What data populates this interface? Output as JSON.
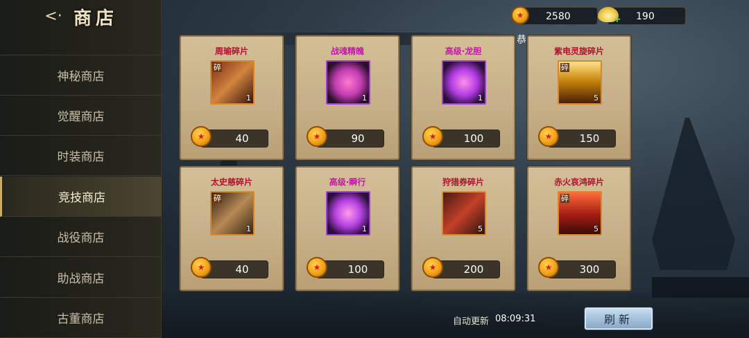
{
  "header": {
    "back_icon": "back-arrow-icon",
    "title": "商店"
  },
  "sidebar": {
    "items": [
      {
        "label": "神秘商店",
        "active": false
      },
      {
        "label": "觉醒商店",
        "active": false
      },
      {
        "label": "时装商店",
        "active": false
      },
      {
        "label": "竞技商店",
        "active": true
      },
      {
        "label": "战役商店",
        "active": false
      },
      {
        "label": "助战商店",
        "active": false
      },
      {
        "label": "古董商店",
        "active": false
      }
    ]
  },
  "currency": {
    "coins": "2580",
    "ingots": "190"
  },
  "notice_fragment": "恭",
  "items": [
    {
      "name": "周瑜碎片",
      "count": "1",
      "price": "40",
      "fragment": "碎",
      "color": "red",
      "frame": "orange"
    },
    {
      "name": "战魂精魄",
      "count": "1",
      "price": "90",
      "fragment": "",
      "color": "pink",
      "frame": "purple"
    },
    {
      "name": "高级·龙胆",
      "count": "1",
      "price": "100",
      "fragment": "",
      "color": "pink",
      "frame": "purple"
    },
    {
      "name": "紫电灵旋碎片",
      "count": "5",
      "price": "150",
      "fragment": "碎",
      "color": "red",
      "frame": "orange"
    },
    {
      "name": "太史慈碎片",
      "count": "1",
      "price": "40",
      "fragment": "碎",
      "color": "red",
      "frame": "orange"
    },
    {
      "name": "高级·瞬行",
      "count": "1",
      "price": "100",
      "fragment": "",
      "color": "pink",
      "frame": "purple"
    },
    {
      "name": "狩猎券碎片",
      "count": "5",
      "price": "200",
      "fragment": "",
      "color": "red",
      "frame": "orange"
    },
    {
      "name": "赤火哀鸿碎片",
      "count": "5",
      "price": "300",
      "fragment": "碎",
      "color": "red",
      "frame": "orange"
    }
  ],
  "footer": {
    "auto_refresh_label": "自动更新",
    "auto_refresh_time": "08:09:31",
    "refresh_button": "刷新"
  }
}
